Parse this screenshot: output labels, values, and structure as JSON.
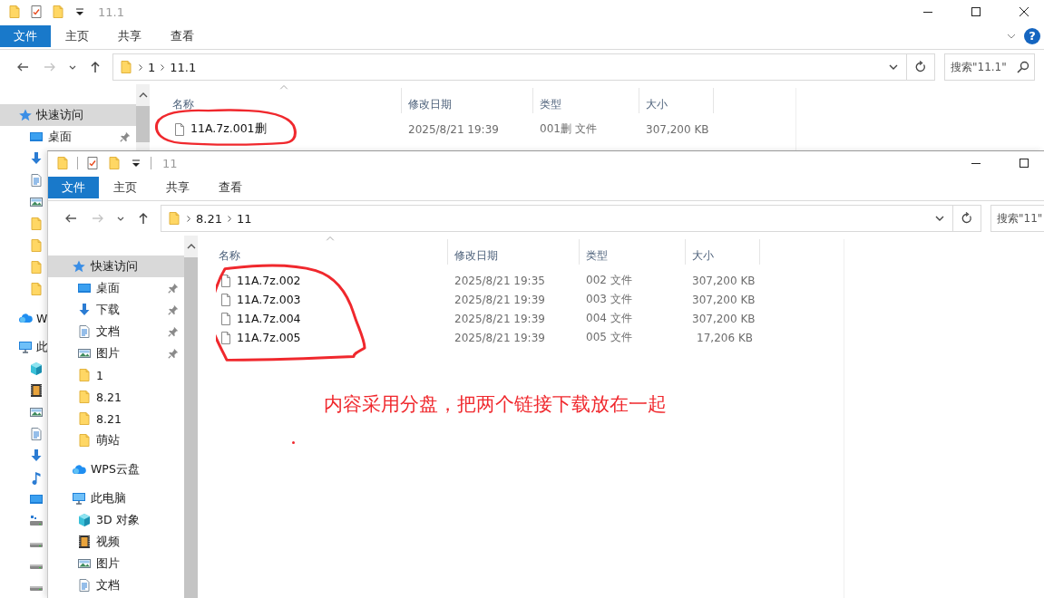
{
  "windows": [
    {
      "title": "11.1",
      "close_button": true,
      "separators": false,
      "ribbon_tabs": [
        {
          "label": "文件",
          "kind": "file"
        },
        {
          "label": "主页",
          "kind": "tab"
        },
        {
          "label": "共享",
          "kind": "tab"
        },
        {
          "label": "查看",
          "kind": "tab"
        }
      ],
      "help": {
        "label": "?"
      },
      "address": [
        "1",
        "11.1"
      ],
      "search": {
        "placeholder": "搜索\"11.1\"",
        "has_icon": true
      },
      "nav": [
        {
          "kind": "star",
          "label": "快速访问",
          "selected": true,
          "children": [
            {
              "kind": "desktop",
              "label": "桌面",
              "pinned": true,
              "selected": false
            },
            {
              "kind": "download",
              "selected": false
            },
            {
              "kind": "document",
              "selected": false
            },
            {
              "kind": "picture",
              "selected": false
            },
            {
              "kind": "folder",
              "selected": false
            },
            {
              "kind": "folder",
              "selected": false
            },
            {
              "kind": "folder",
              "selected": false
            },
            {
              "kind": "folder",
              "selected": false
            }
          ]
        },
        {
          "kind": "cloud",
          "label": "W",
          "selected": false
        },
        {
          "kind": "computer",
          "label": "此",
          "selected": false,
          "children": [
            {
              "kind": "cube",
              "selected": false
            },
            {
              "kind": "video",
              "selected": false
            },
            {
              "kind": "picture",
              "selected": false
            },
            {
              "kind": "document",
              "selected": false
            },
            {
              "kind": "download",
              "selected": false
            },
            {
              "kind": "music",
              "selected": false
            },
            {
              "kind": "desktop",
              "selected": false
            },
            {
              "kind": "netdrive",
              "selected": false
            },
            {
              "kind": "drive",
              "selected": false
            },
            {
              "kind": "drive",
              "selected": false
            },
            {
              "kind": "drive",
              "selected": false
            }
          ]
        }
      ],
      "columns": [
        {
          "label": "名称",
          "sorted": true
        },
        {
          "label": "修改日期",
          "sorted": false
        },
        {
          "label": "类型",
          "sorted": false
        },
        {
          "label": "大小",
          "sorted": false
        }
      ],
      "files": [
        {
          "name": "11A.7z.001删",
          "date": "2025/8/21 19:39",
          "type": "001删 文件",
          "size": "307,200 KB"
        }
      ],
      "circled": true
    },
    {
      "title": "11",
      "close_button": false,
      "separators": true,
      "ribbon_tabs": [
        {
          "label": "文件",
          "kind": "file"
        },
        {
          "label": "主页",
          "kind": "tab"
        },
        {
          "label": "共享",
          "kind": "tab"
        },
        {
          "label": "查看",
          "kind": "tab"
        }
      ],
      "address": [
        "8.21",
        "11"
      ],
      "search": {
        "placeholder": "搜索\"11\"",
        "has_icon": false
      },
      "nav": [
        {
          "kind": "star",
          "label": "快速访问",
          "selected": true,
          "children": [
            {
              "kind": "desktop",
              "label": "桌面",
              "pinned": true,
              "selected": false
            },
            {
              "kind": "download",
              "label": "下载",
              "pinned": true,
              "selected": false
            },
            {
              "kind": "document",
              "label": "文档",
              "pinned": true,
              "selected": false
            },
            {
              "kind": "picture",
              "label": "图片",
              "pinned": true,
              "selected": false
            },
            {
              "kind": "folder",
              "label": "1",
              "pinned": false,
              "selected": false
            },
            {
              "kind": "folder",
              "label": "8.21",
              "pinned": false,
              "selected": false
            },
            {
              "kind": "folder",
              "label": "8.21",
              "pinned": false,
              "selected": false
            },
            {
              "kind": "folder",
              "label": "萌站",
              "pinned": false,
              "selected": false
            }
          ]
        },
        {
          "kind": "cloud",
          "label": "WPS云盘",
          "selected": false
        },
        {
          "kind": "computer",
          "label": "此电脑",
          "selected": false,
          "children": [
            {
              "kind": "cube",
              "label": "3D 对象",
              "selected": false
            },
            {
              "kind": "video",
              "label": "视频",
              "selected": false
            },
            {
              "kind": "picture",
              "label": "图片",
              "selected": false
            },
            {
              "kind": "document",
              "label": "文档",
              "selected": false
            }
          ]
        }
      ],
      "columns": [
        {
          "label": "名称",
          "sorted": true
        },
        {
          "label": "修改日期",
          "sorted": false
        },
        {
          "label": "类型",
          "sorted": false
        },
        {
          "label": "大小",
          "sorted": false
        }
      ],
      "files": [
        {
          "name": "11A.7z.002",
          "date": "2025/8/21 19:35",
          "type": "002 文件",
          "size": "307,200 KB"
        },
        {
          "name": "11A.7z.003",
          "date": "2025/8/21 19:39",
          "type": "003 文件",
          "size": "307,200 KB"
        },
        {
          "name": "11A.7z.004",
          "date": "2025/8/21 19:39",
          "type": "004 文件",
          "size": "307,200 KB"
        },
        {
          "name": "11A.7z.005",
          "date": "2025/8/21 19:39",
          "type": "005 文件",
          "size": "17,206 KB"
        }
      ],
      "circled": true
    }
  ],
  "note": {
    "text": "内容采用分盘，把两个链接下载放在一起"
  }
}
